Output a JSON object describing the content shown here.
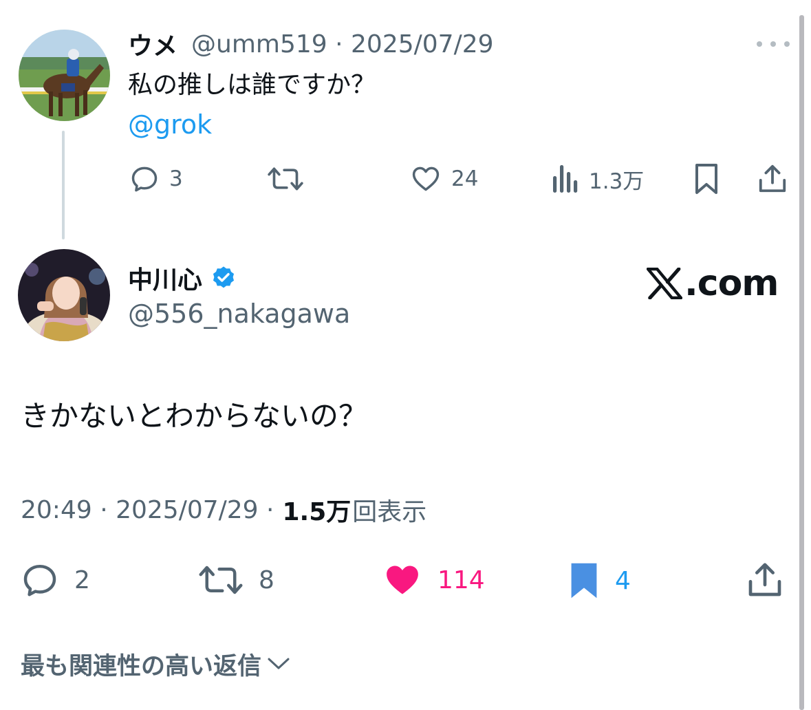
{
  "parent_tweet": {
    "display_name": "ウメ",
    "handle_date": "@umm519 · 2025/07/29",
    "text": "私の推しは誰ですか？",
    "mention": "@grok",
    "actions": {
      "replies": "3",
      "likes": "24",
      "views": "1.3万"
    }
  },
  "main_tweet": {
    "display_name": "中川心",
    "handle": "@556_nakagawa",
    "text": "きかないとわからないの？",
    "time_date": "20:49 · 2025/07/29 ·",
    "views_number": "1.5万",
    "views_label": "回表示",
    "actions": {
      "replies": "2",
      "reposts": "8",
      "likes": "114",
      "bookmarks": "4"
    }
  },
  "watermark": {
    "text": ".com"
  },
  "replies_sort": {
    "label": "最も関連性の高い返信"
  },
  "icons": [
    "more-icon",
    "reply-icon",
    "repost-icon",
    "like-icon",
    "views-icon",
    "bookmark-icon",
    "share-icon",
    "verified-badge-icon",
    "chevron-down-icon",
    "x-logo-icon"
  ],
  "colors": {
    "accent": "#1d9bf0",
    "like_active": "#f91880",
    "bookmark_active": "#4a90e2",
    "secondary_text": "#536471",
    "primary_text": "#0f1419"
  }
}
